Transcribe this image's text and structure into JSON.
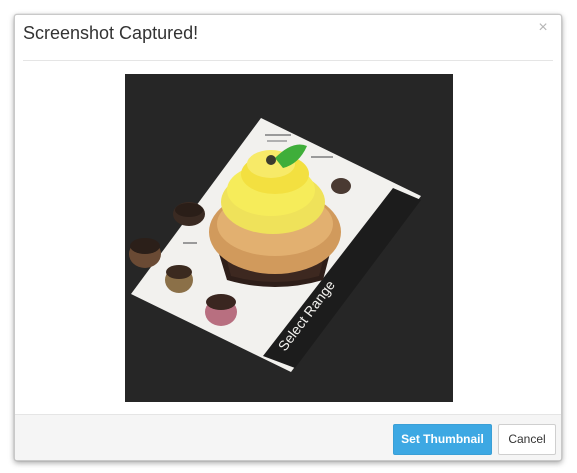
{
  "dialog": {
    "title": "Screenshot Captured!",
    "close_icon": "close-icon",
    "close_glyph": "×"
  },
  "preview": {
    "menu_label": "Select Range"
  },
  "footer": {
    "set_thumbnail_label": "Set Thumbnail",
    "cancel_label": "Cancel"
  },
  "colors": {
    "primary_button": "#3da8e3",
    "preview_background": "#262626"
  }
}
